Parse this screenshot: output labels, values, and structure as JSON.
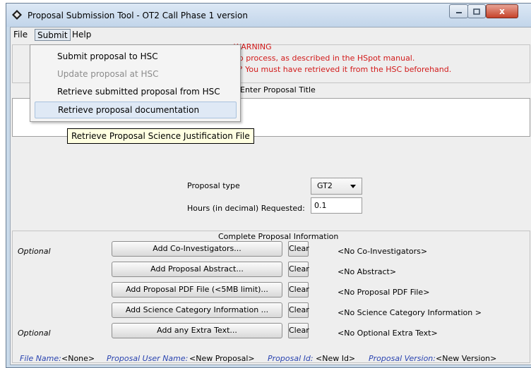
{
  "window": {
    "title": "Proposal Submission Tool - OT2 Call Phase 1 version",
    "close_glyph": "x"
  },
  "menubar": {
    "file": "File",
    "submit": "Submit",
    "help": "Help"
  },
  "submit_menu": {
    "items": [
      {
        "label": "Submit proposal to HSC",
        "enabled": true
      },
      {
        "label": "Update proposal at HSC",
        "enabled": false
      },
      {
        "label": "Retrieve submitted proposal from HSC",
        "enabled": true
      },
      {
        "label": "Retrieve proposal documentation",
        "enabled": true,
        "highlighted": true
      }
    ]
  },
  "tooltip": "Retrieve Proposal Science Justification File",
  "warning": {
    "title": "WARNING",
    "line1": "ep process, as described in the HSpot manual.",
    "line2": "e? You must have retrieved it from the HSC beforehand."
  },
  "proposal_title": {
    "label": "Enter Proposal Title",
    "value": ""
  },
  "proposal_type": {
    "label": "Proposal type",
    "value": "GT2"
  },
  "hours": {
    "label": "Hours (in decimal) Requested:",
    "value": "0.1"
  },
  "info": {
    "header": "Complete Proposal Information",
    "rows": [
      {
        "optional": "Optional",
        "button": "Add Co-Investigators...",
        "clear": "Clear",
        "status": "<No Co-Investigators>"
      },
      {
        "optional": "",
        "button": "Add Proposal Abstract...",
        "clear": "Clear",
        "status": "<No Abstract>"
      },
      {
        "optional": "",
        "button": "Add Proposal PDF File (<5MB limit)...",
        "clear": "Clear",
        "status": "<No Proposal PDF File>"
      },
      {
        "optional": "",
        "button": "Add Science Category Information ...",
        "clear": "Clear",
        "status": "<No Science Category Information >"
      },
      {
        "optional": "Optional",
        "button": "Add any Extra Text...",
        "clear": "Clear",
        "status": "<No Optional Extra Text>"
      }
    ]
  },
  "statusbar": {
    "file_name_label": "File Name:",
    "file_name_value": "<None>",
    "user_name_label": "Proposal User Name:",
    "user_name_value": "<New Proposal>",
    "id_label": "Proposal Id:",
    "id_value": "<New Id>",
    "version_label": "Proposal Version:",
    "version_value": "<New Version>"
  },
  "colors": {
    "warning_text": "#d21a1a",
    "status_label": "#2a44b0",
    "menu_highlight": "#dfe9f5"
  }
}
